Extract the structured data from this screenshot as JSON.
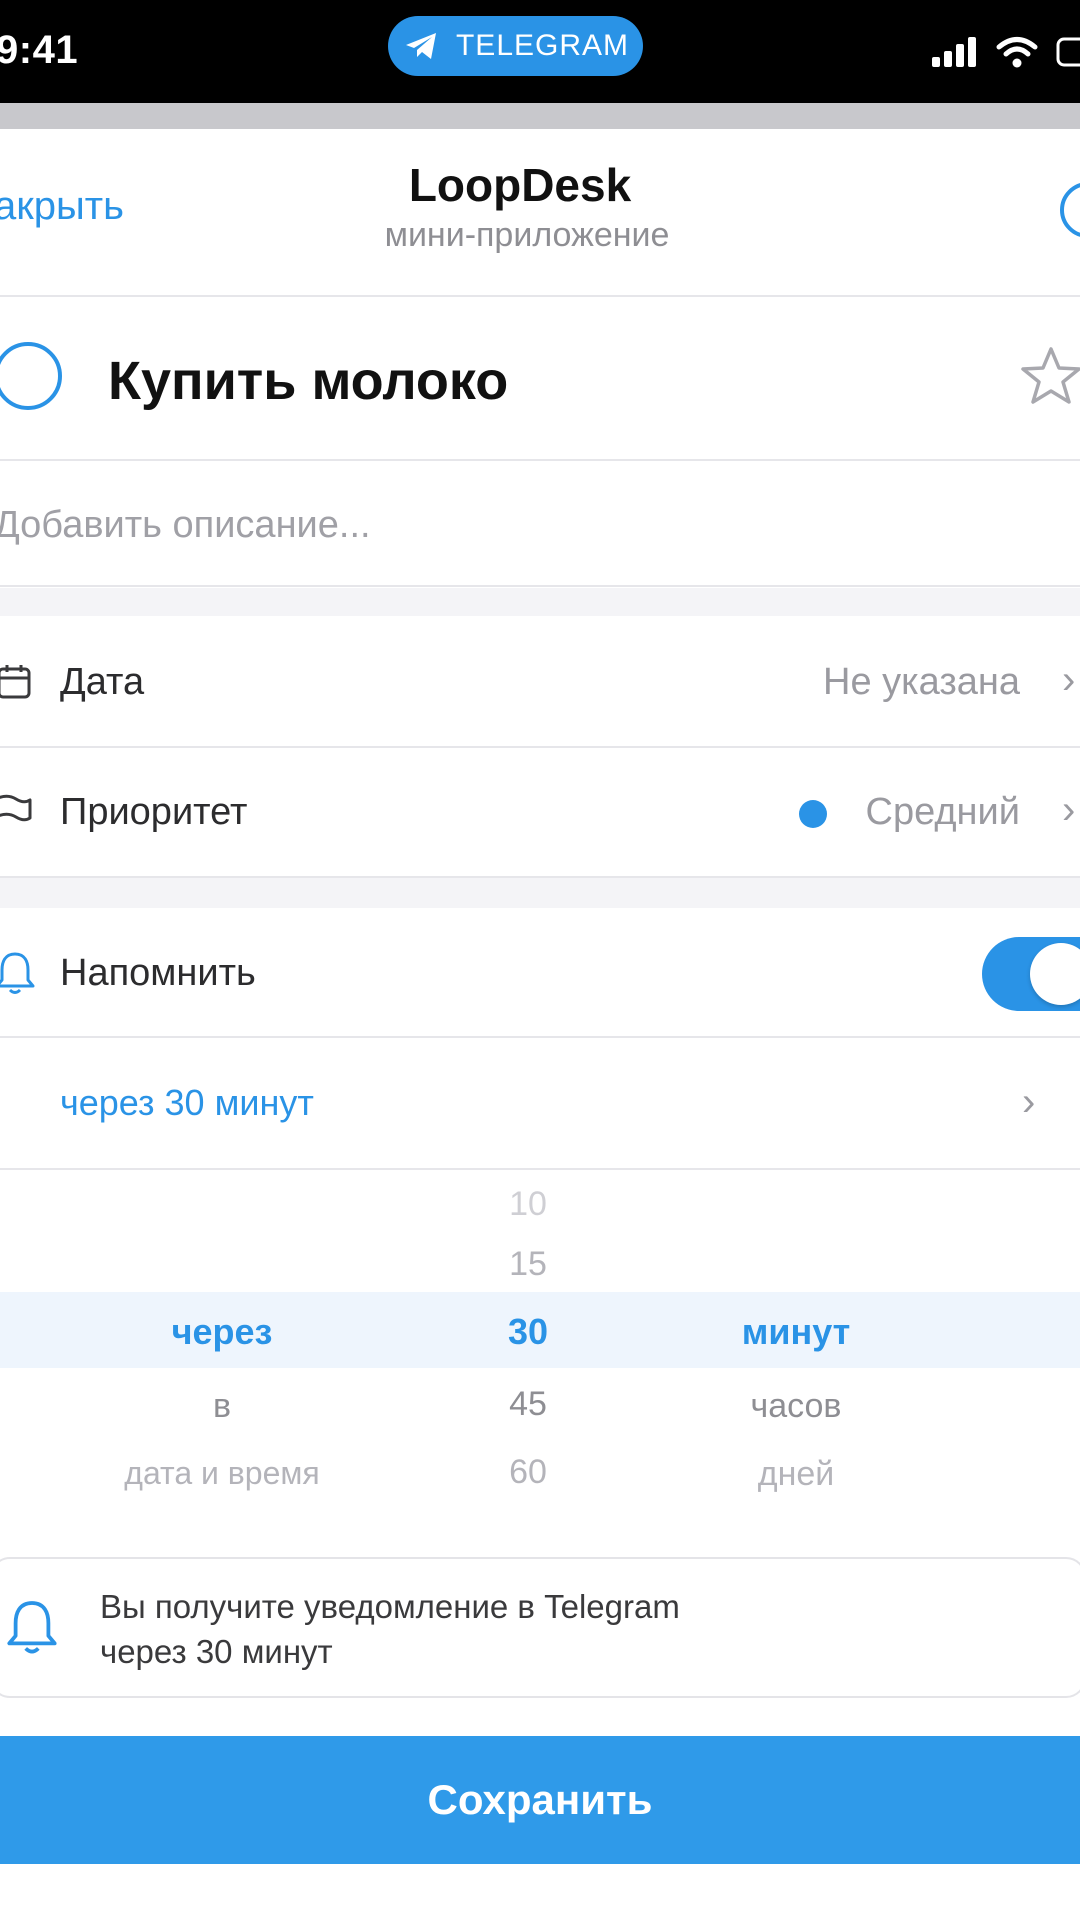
{
  "status_bar": {
    "time": "9:41",
    "pill_label": "TELEGRAM"
  },
  "header": {
    "close_label": "акрыть",
    "title": "LoopDesk",
    "subtitle": "мини-приложение"
  },
  "task": {
    "title": "Купить молоко",
    "description_placeholder": "Добавить описание..."
  },
  "rows": {
    "date": {
      "label": "Дата",
      "value": "Не указана"
    },
    "priority": {
      "label": "Приоритет",
      "value": "Средний",
      "dot_color": "#2a93e6"
    },
    "remind": {
      "label": "Напомнить",
      "enabled": true,
      "value": "через 30 минут"
    }
  },
  "picker": {
    "col1": [
      "через",
      "в",
      "дата и время"
    ],
    "col2": [
      "10",
      "15",
      "30",
      "45",
      "60"
    ],
    "col3": [
      "минут",
      "часов",
      "дней"
    ]
  },
  "info": {
    "line1": "Вы получите уведомление в Telegram",
    "line2": "через 30 минут"
  },
  "save_label": "Сохранить",
  "colors": {
    "accent": "#2a93e6",
    "save": "#2f9ae9"
  }
}
